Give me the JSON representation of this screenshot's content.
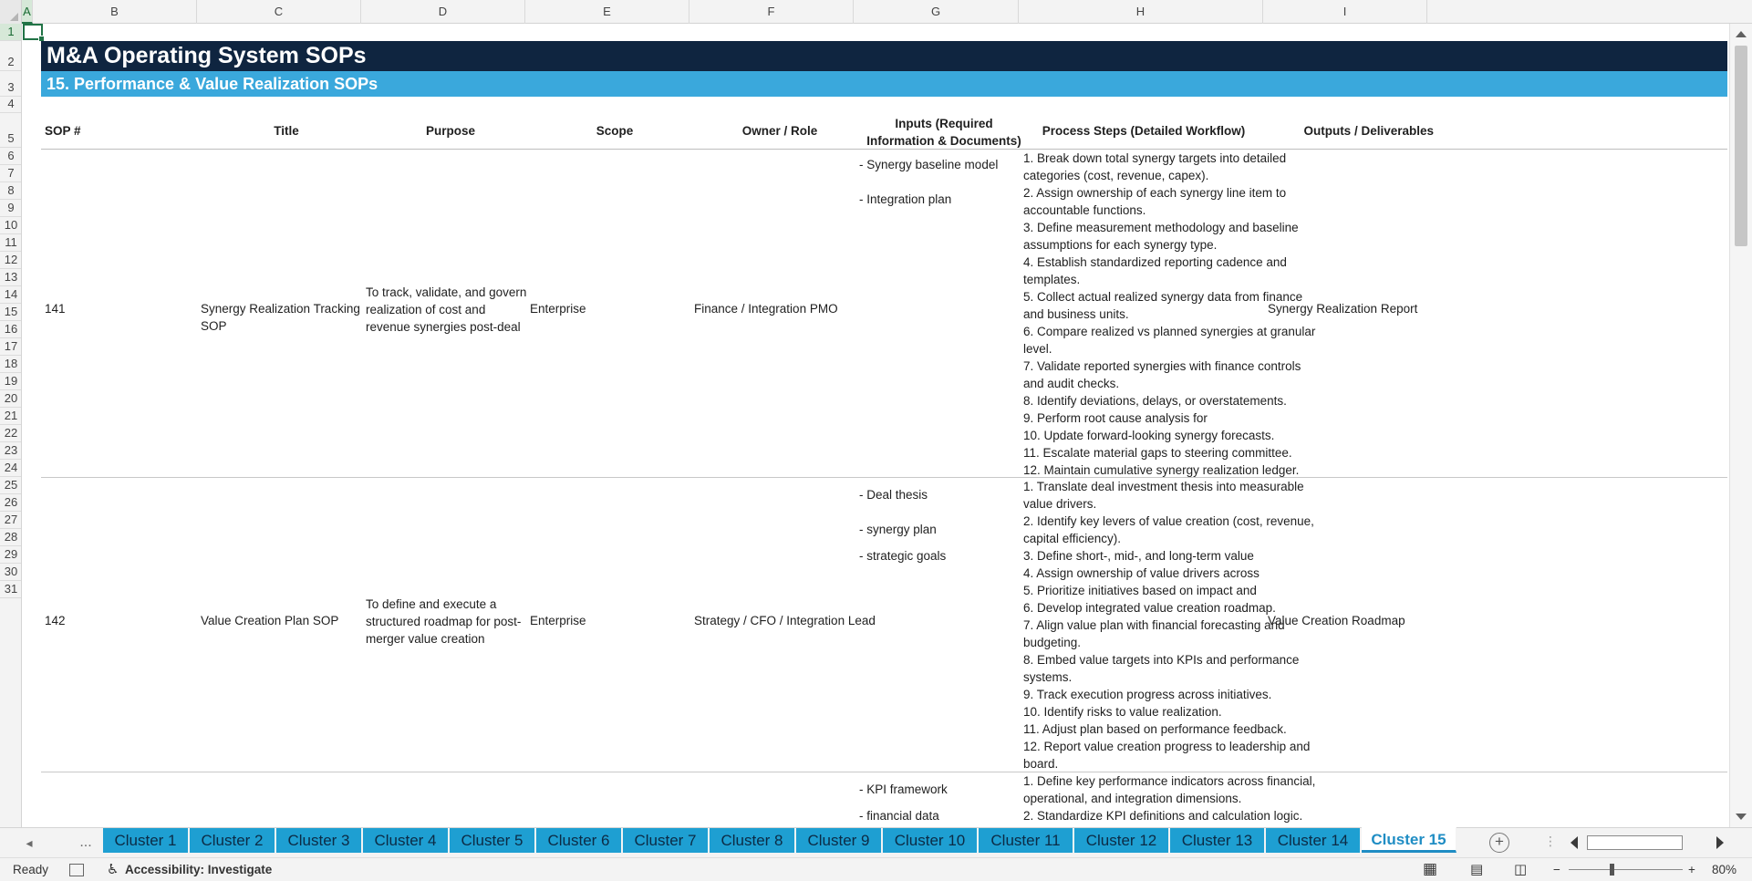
{
  "columns": [
    {
      "label": "A",
      "active": true
    },
    {
      "label": "B"
    },
    {
      "label": "C"
    },
    {
      "label": "D"
    },
    {
      "label": "E"
    },
    {
      "label": "F"
    },
    {
      "label": "G"
    },
    {
      "label": "H"
    },
    {
      "label": "I"
    }
  ],
  "rows": [
    "1",
    "2",
    "3",
    "4",
    "5",
    "6",
    "7",
    "8",
    "9",
    "10",
    "11",
    "12",
    "13",
    "14",
    "15",
    "16",
    "17",
    "18",
    "19",
    "20",
    "21",
    "22",
    "23",
    "24",
    "25",
    "26",
    "27",
    "28",
    "29",
    "30",
    "31"
  ],
  "sheet": {
    "title": "M&A Operating System SOPs",
    "subtitle": "15. Performance & Value Realization SOPs",
    "headers": {
      "sop": "SOP #",
      "title": "Title",
      "purpose": "Purpose",
      "scope": "Scope",
      "owner": "Owner / Role",
      "inputs": "Inputs (Required Information & Documents)",
      "steps": "Process Steps (Detailed Workflow)",
      "outputs": "Outputs / Deliverables"
    },
    "records": [
      {
        "sop": "141",
        "title": "Synergy Realization Tracking SOP",
        "purpose": "To track, validate, and govern realization of cost and revenue synergies post-deal",
        "scope": "Enterprise",
        "owner": "Finance / Integration PMO",
        "inputs": [
          "- Synergy baseline model",
          "- Integration plan"
        ],
        "steps": [
          "1. Break down total synergy targets into detailed categories (cost, revenue, capex).",
          "2. Assign ownership of each synergy line item to accountable functions.",
          "3. Define measurement methodology and baseline assumptions for each synergy type.",
          "4. Establish standardized reporting cadence and templates.",
          "5. Collect actual realized synergy data from finance and business units.",
          "6. Compare realized vs planned synergies at granular level.",
          "7. Validate reported synergies with finance controls and audit checks.",
          "8. Identify deviations, delays, or overstatements.",
          "9. Perform root cause analysis for",
          "10. Update forward-looking synergy forecasts.",
          "11. Escalate material gaps to steering committee.",
          "12. Maintain cumulative synergy realization ledger."
        ],
        "outputs": "Synergy Realization Report"
      },
      {
        "sop": "142",
        "title": "Value Creation Plan SOP",
        "purpose": "To define and execute a structured roadmap for post-merger value creation",
        "scope": "Enterprise",
        "owner": "Strategy / CFO / Integration Lead",
        "inputs": [
          "- Deal thesis",
          "- synergy plan",
          "- strategic goals"
        ],
        "steps": [
          "1. Translate deal investment thesis into measurable value drivers.",
          "2. Identify key levers of value creation (cost, revenue, capital efficiency).",
          "3. Define short-, mid-, and long-term value",
          "4. Assign ownership of value drivers across",
          "5. Prioritize initiatives based on impact and",
          "6. Develop integrated value creation roadmap.",
          "7. Align value plan with financial forecasting and budgeting.",
          "8. Embed value targets into KPIs and performance systems.",
          "9. Track execution progress across initiatives.",
          "10. Identify risks to value realization.",
          "11. Adjust plan based on performance feedback.",
          "12. Report value creation progress to leadership and board."
        ],
        "outputs": "Value Creation Roadmap"
      },
      {
        "inputs": [
          "- KPI framework",
          "- financial data"
        ],
        "steps": [
          "1. Define key performance indicators across financial, operational, and integration dimensions.",
          "2. Standardize KPI definitions and calculation logic."
        ]
      }
    ]
  },
  "tabs": {
    "overflow": "...",
    "items": [
      "Cluster 1",
      "Cluster 2",
      "Cluster 3",
      "Cluster 4",
      "Cluster 5",
      "Cluster 6",
      "Cluster 7",
      "Cluster 8",
      "Cluster 9",
      "Cluster 10",
      "Cluster 11",
      "Cluster 12",
      "Cluster 13",
      "Cluster 14",
      "Cluster 15"
    ],
    "active_index": 14,
    "add": "+"
  },
  "status": {
    "ready": "Ready",
    "accessibility": "Accessibility: Investigate",
    "zoom": "80%",
    "zoom_minus": "−",
    "zoom_plus": "+"
  }
}
